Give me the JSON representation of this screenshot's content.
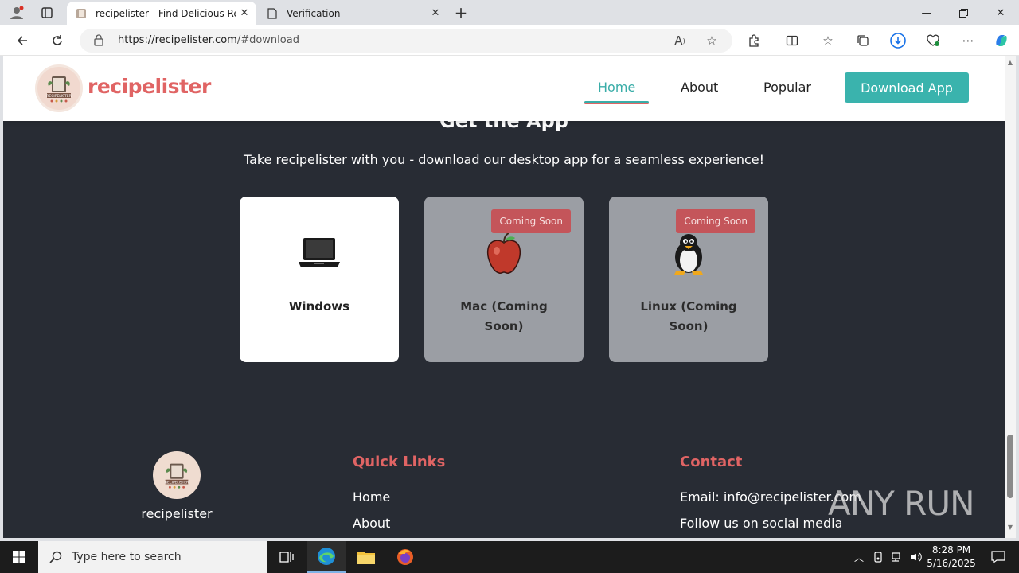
{
  "browser": {
    "tabs": [
      {
        "title": "recipelister - Find Delicious Recip",
        "active": true
      },
      {
        "title": "Verification",
        "active": false
      }
    ],
    "url_host": "https://recipelister.com",
    "url_path": "/#download"
  },
  "site": {
    "brand": "recipelister",
    "logo_text": "RECIPELISTER",
    "nav": {
      "home": "Home",
      "about": "About",
      "popular": "Popular",
      "download": "Download App"
    },
    "download_section": {
      "title": "Get the App",
      "subtitle": "Take recipelister with you - download our desktop app for a seamless experience!",
      "cards": [
        {
          "label": "Windows",
          "icon": "laptop-icon",
          "badge": ""
        },
        {
          "label": "Mac (Coming Soon)",
          "icon": "apple-icon",
          "badge": "Coming Soon"
        },
        {
          "label": "Linux (Coming Soon)",
          "icon": "penguin-icon",
          "badge": "Coming Soon"
        }
      ]
    },
    "footer": {
      "brand": "recipelister",
      "quick_links_title": "Quick Links",
      "quick_links": [
        "Home",
        "About"
      ],
      "contact_title": "Contact",
      "email": "Email: info@recipelister.com",
      "social": "Follow us on social media"
    }
  },
  "watermark": "ANY RUN",
  "taskbar": {
    "search_placeholder": "Type here to search",
    "time": "8:28 PM",
    "date": "5/16/2025"
  },
  "colors": {
    "accent_teal": "#3ab3ad",
    "brand_red": "#e06464",
    "section_bg": "#282c34",
    "badge_bg": "#c4555a"
  }
}
